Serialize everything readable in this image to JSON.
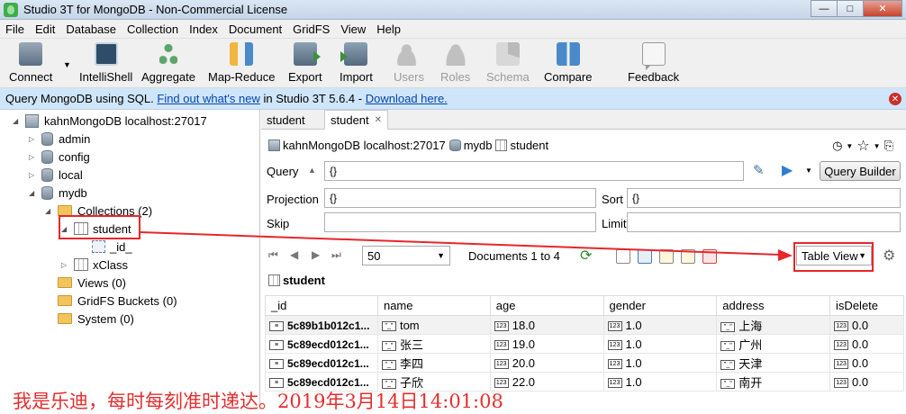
{
  "window": {
    "title": "Studio 3T for MongoDB - Non-Commercial License"
  },
  "menu": [
    "File",
    "Edit",
    "Database",
    "Collection",
    "Index",
    "Document",
    "GridFS",
    "View",
    "Help"
  ],
  "toolbar": {
    "connect": "Connect",
    "intellishell": "IntelliShell",
    "aggregate": "Aggregate",
    "map_reduce": "Map-Reduce",
    "export": "Export",
    "import": "Import",
    "users": "Users",
    "roles": "Roles",
    "schema": "Schema",
    "compare": "Compare",
    "feedback": "Feedback"
  },
  "banner": {
    "text1": "Query MongoDB using SQL.",
    "link1": "Find out what's new",
    "text2": "in Studio 3T 5.6.4 -",
    "link2": "Download here."
  },
  "tree": {
    "server": "kahnMongoDB localhost:27017",
    "dbs": [
      "admin",
      "config",
      "local",
      "mydb"
    ],
    "collections_label": "Collections (2)",
    "student": "student",
    "field_id": "_id_",
    "xclass": "xClass",
    "views": "Views (0)",
    "gridfs": "GridFS Buckets (0)",
    "system": "System (0)"
  },
  "tabs": {
    "tab1": "student",
    "tab2": "student"
  },
  "breadcrumb": {
    "server": "kahnMongoDB localhost:27017",
    "db": "mydb",
    "collection": "student"
  },
  "query": {
    "query_label": "Query",
    "query_value": "{}",
    "query_builder": "Query Builder",
    "projection_label": "Projection",
    "projection_value": "{}",
    "sort_label": "Sort",
    "sort_value": "{}",
    "skip_label": "Skip",
    "limit_label": "Limit"
  },
  "results": {
    "page_size": "50",
    "documents": "Documents 1 to 4",
    "view_mode": "Table View",
    "collection_title": "student",
    "columns": [
      "_id",
      "name",
      "age",
      "gender",
      "address",
      "isDelete"
    ],
    "rows": [
      {
        "_id": "5c89b1b012c1...",
        "name": "tom",
        "age": "18.0",
        "gender": "1.0",
        "address": "上海",
        "isDelete": "0.0"
      },
      {
        "_id": "5c89ecd012c1...",
        "name": "张三",
        "age": "19.0",
        "gender": "1.0",
        "address": "广州",
        "isDelete": "0.0"
      },
      {
        "_id": "5c89ecd012c1...",
        "name": "李四",
        "age": "20.0",
        "gender": "1.0",
        "address": "天津",
        "isDelete": "0.0"
      },
      {
        "_id": "5c89ecd012c1...",
        "name": "子欣",
        "age": "22.0",
        "gender": "1.0",
        "address": "南开",
        "isDelete": "0.0"
      }
    ]
  },
  "watermark": "我是乐迪，每时每刻准时递达。2019年3月14日14:01:08",
  "colors": {
    "accent_red": "#e8262b",
    "banner_bg": "#cfe6fa",
    "link": "#0645ad"
  }
}
